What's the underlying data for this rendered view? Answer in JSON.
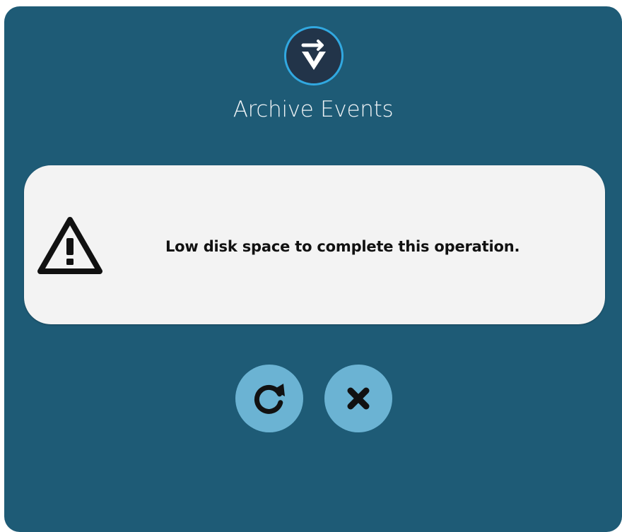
{
  "dialog": {
    "title": "Archive Events",
    "message": "Low disk space to complete this operation."
  },
  "icons": {
    "logo": "v-logo-icon",
    "warning": "warning-triangle-icon",
    "retry": "retry-icon",
    "close": "close-icon"
  },
  "colors": {
    "dialog_background": "#1e5b76",
    "card_background": "#f3f3f3",
    "button_background": "#6bb3d3",
    "logo_ring": "#31a8e0",
    "logo_fill": "#223449"
  }
}
